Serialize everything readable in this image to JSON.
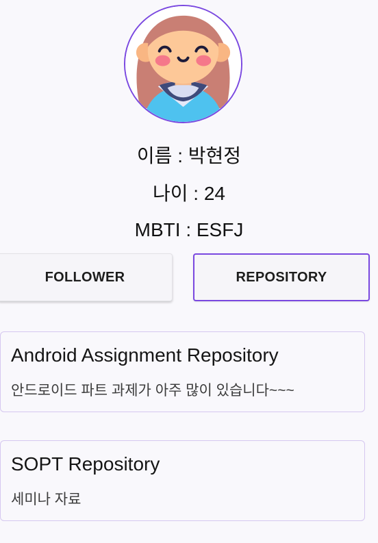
{
  "profile": {
    "name_line": "이름 : 박현정",
    "age_line": "나이 : 24",
    "mbti_line": "MBTI : ESFJ",
    "avatar_icon": "girl-avatar-icon",
    "accent_color": "#7a48e0"
  },
  "tabs": {
    "follower_label": "FOLLOWER",
    "repository_label": "REPOSITORY",
    "selected": "repository"
  },
  "repositories": [
    {
      "title": "Android Assignment Repository",
      "description": "안드로이드 파트 과제가 아주 많이 있습니다~~~"
    },
    {
      "title": "SOPT Repository",
      "description": "세미나 자료"
    }
  ]
}
